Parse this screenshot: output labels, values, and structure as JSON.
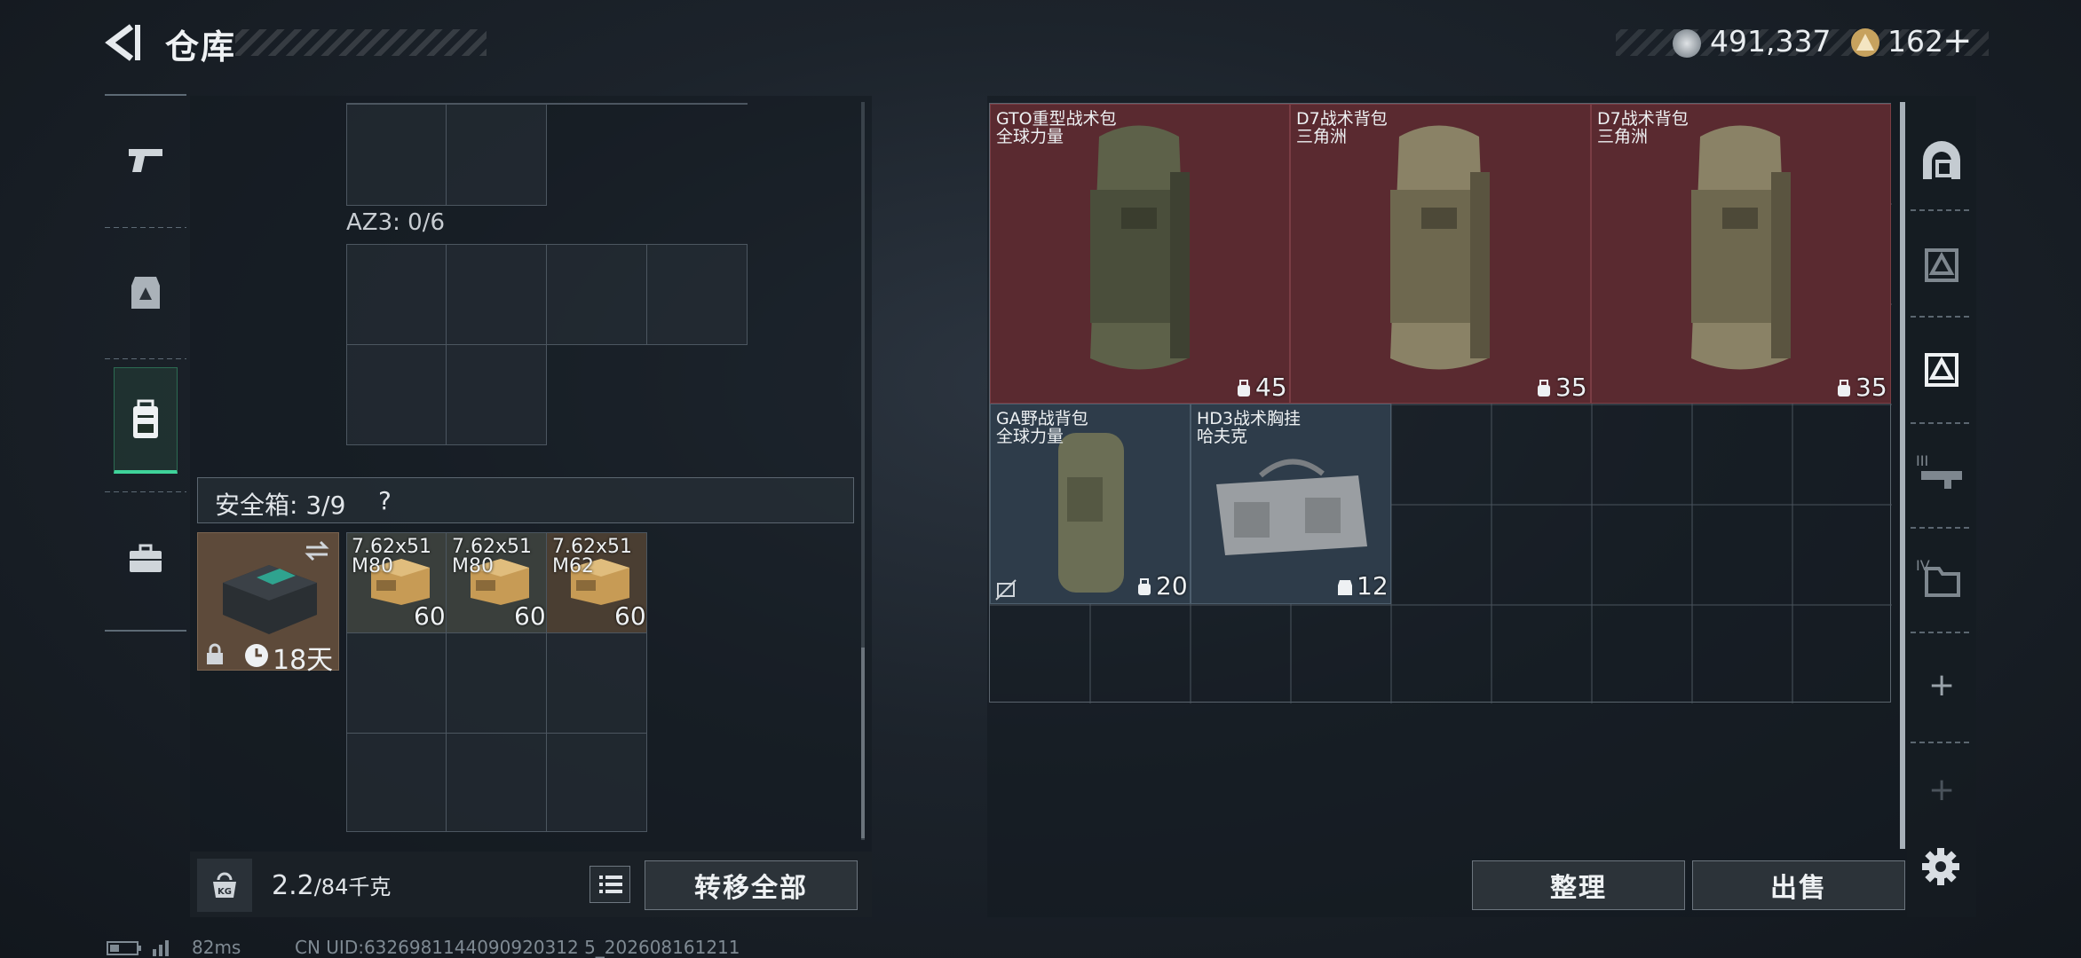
{
  "header": {
    "title": "仓库",
    "currency": [
      {
        "icon": "silver-coin-icon",
        "value": "491,337"
      },
      {
        "icon": "gold-coin-icon",
        "value": "162"
      }
    ],
    "add_label": "+"
  },
  "left_nav": {
    "items": [
      {
        "icon": "pistol-icon",
        "active": false
      },
      {
        "icon": "armor-vest-icon",
        "active": false
      },
      {
        "icon": "backpack-icon",
        "active": true
      },
      {
        "icon": "briefcase-icon",
        "active": false
      }
    ]
  },
  "left_panel": {
    "az3_label": "AZ3: 0/6",
    "safe_box_label": "安全箱: 3/9",
    "help_label": "?",
    "safe_box_item": {
      "timer": "18天"
    },
    "ammo": [
      {
        "line1": "7.62x51",
        "line2": "M80",
        "count": "60"
      },
      {
        "line1": "7.62x51",
        "line2": "M80",
        "count": "60"
      },
      {
        "line1": "7.62x51",
        "line2": "M62",
        "count": "60"
      }
    ],
    "weight": "2.2",
    "weight_max": "/84千克",
    "transfer_all": "转移全部"
  },
  "stash": {
    "items": [
      {
        "name": "GTO重型战术包",
        "sub": "全球力量",
        "count": "45",
        "color": "#5a2a30"
      },
      {
        "name": "D7战术背包",
        "sub": "三角洲",
        "count": "35",
        "color": "#5a2a30"
      },
      {
        "name": "D7战术背包",
        "sub": "三角洲",
        "count": "35",
        "color": "#5a2a30"
      },
      {
        "name": "GA野战背包",
        "sub": "全球力量",
        "count": "20",
        "color": "#2e3c4a"
      },
      {
        "name": "HD3战术胸挂",
        "sub": "哈夫克",
        "count": "12",
        "color": "#2e3c4a"
      }
    ],
    "organize": "整理",
    "sell": "出售"
  },
  "right_nav": {
    "tab_labels": [
      "III",
      "IV"
    ],
    "add_labels": [
      "+",
      "+"
    ]
  },
  "status_bar": {
    "ping": "82ms",
    "uid": "CN UID:6326981144090920312 5_202608161211"
  },
  "colors": {
    "accent": "#3fd39a",
    "rare_bg": "#5a2a30",
    "common_bg": "#2e3c4a"
  }
}
